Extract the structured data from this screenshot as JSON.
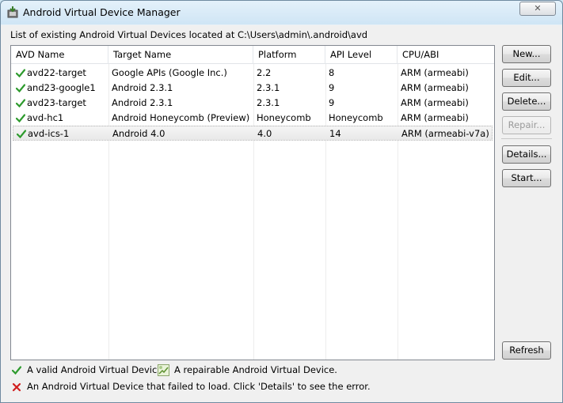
{
  "window": {
    "title": "Android Virtual Device Manager",
    "close_glyph": "✕"
  },
  "header": {
    "text": "List of existing Android Virtual Devices located at C:\\Users\\admin\\.android\\avd"
  },
  "table": {
    "columns": [
      "AVD Name",
      "Target Name",
      "Platform",
      "API Level",
      "CPU/ABI"
    ],
    "rows": [
      {
        "status": "valid",
        "name": "avd22-target",
        "target": "Google APIs (Google Inc.)",
        "platform": "2.2",
        "api": "8",
        "cpu": "ARM (armeabi)",
        "selected": false
      },
      {
        "status": "valid",
        "name": "and23-google1",
        "target": "Android 2.3.1",
        "platform": "2.3.1",
        "api": "9",
        "cpu": "ARM (armeabi)",
        "selected": false
      },
      {
        "status": "valid",
        "name": "avd23-target",
        "target": "Android 2.3.1",
        "platform": "2.3.1",
        "api": "9",
        "cpu": "ARM (armeabi)",
        "selected": false
      },
      {
        "status": "valid",
        "name": "avd-hc1",
        "target": "Android Honeycomb (Preview)",
        "platform": "Honeycomb",
        "api": "Honeycomb",
        "cpu": "ARM (armeabi)",
        "selected": false
      },
      {
        "status": "valid",
        "name": "avd-ics-1",
        "target": "Android 4.0",
        "platform": "4.0",
        "api": "14",
        "cpu": "ARM (armeabi-v7a)",
        "selected": true
      }
    ]
  },
  "buttons": {
    "new": "New...",
    "edit": "Edit...",
    "delete": "Delete...",
    "repair": "Repair...",
    "details": "Details...",
    "start": "Start...",
    "refresh": "Refresh"
  },
  "legend": {
    "valid": "A valid Android Virtual Device.",
    "repairable": "A repairable Android Virtual Device.",
    "failed": "An Android Virtual Device that failed to load. Click 'Details' to see the error."
  },
  "colors": {
    "check": "#2e9b2e",
    "error": "#d01f1f",
    "selected_row": "#e8e8e8"
  },
  "icons": {
    "valid": "check-icon",
    "repairable": "repair-icon",
    "failed": "error-x-icon",
    "app": "android-sdk-icon"
  }
}
